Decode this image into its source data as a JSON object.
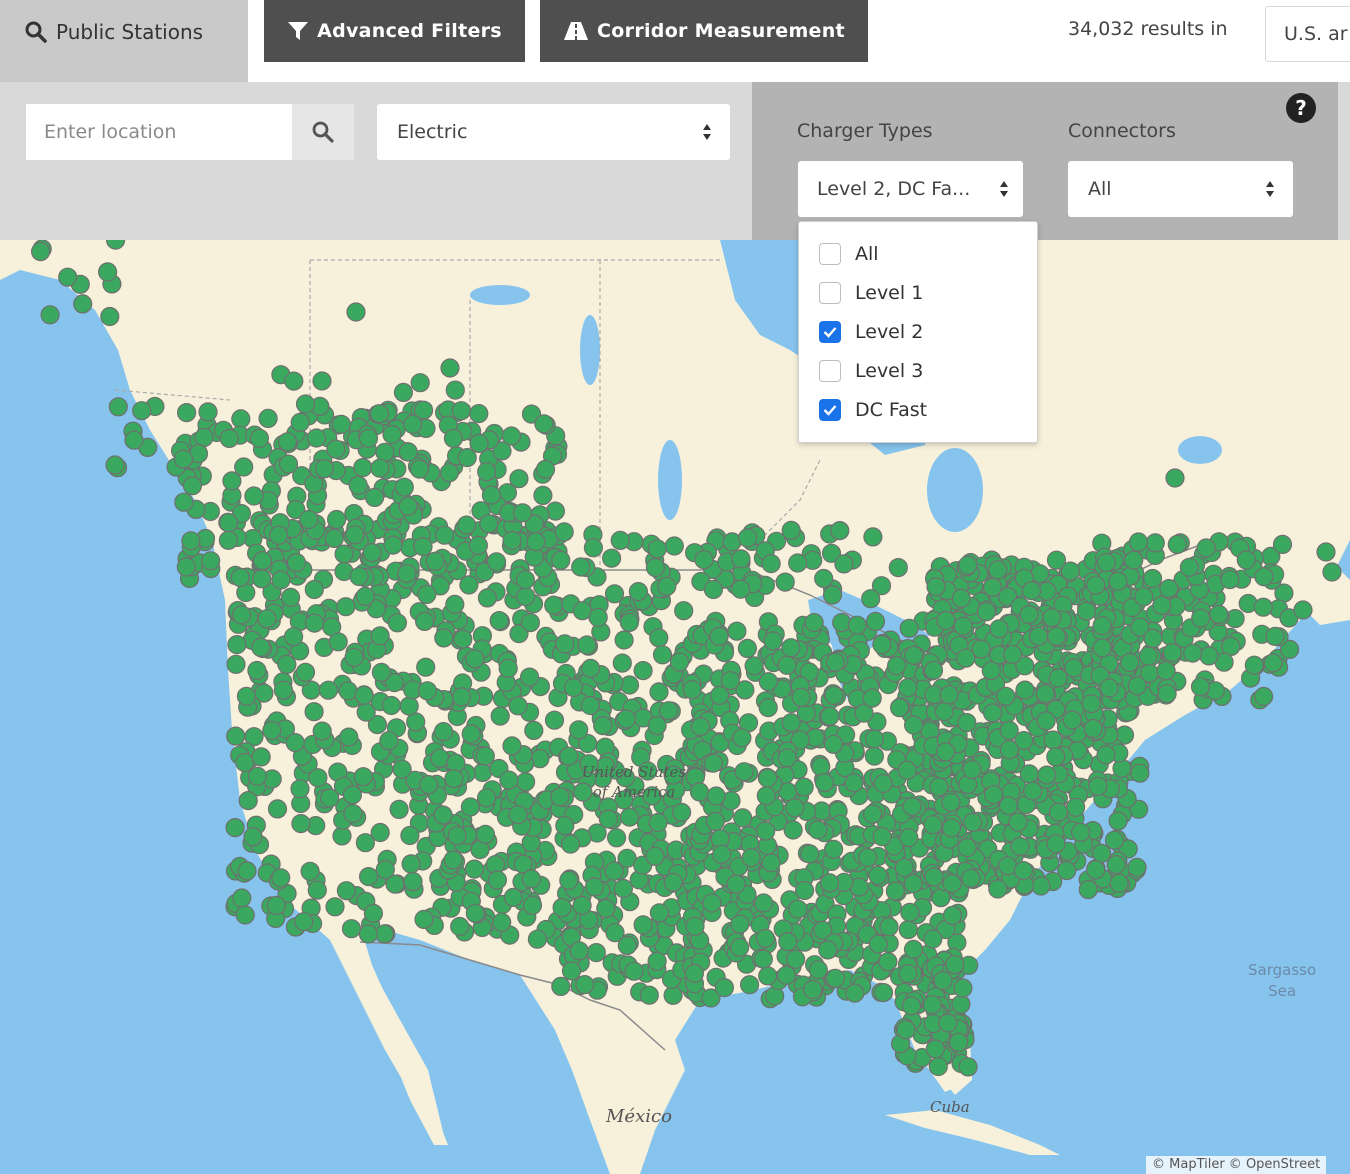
{
  "header": {
    "tab_public": "Public Stations",
    "advanced_filters": "Advanced Filters",
    "corridor_measurement": "Corridor Measurement",
    "results_text": "34,032 results in",
    "country_value": "U.S. ar"
  },
  "filters": {
    "location_placeholder": "Enter location",
    "fuel_value": "Electric",
    "charger_types_label": "Charger Types",
    "charger_types_value": "Level 2, DC Fa...",
    "connectors_label": "Connectors",
    "connectors_value": "All",
    "help_glyph": "?"
  },
  "charger_options": [
    {
      "label": "All",
      "checked": false
    },
    {
      "label": "Level 1",
      "checked": false
    },
    {
      "label": "Level 2",
      "checked": true
    },
    {
      "label": "Level 3",
      "checked": false
    },
    {
      "label": "DC Fast",
      "checked": true
    }
  ],
  "map": {
    "labels": {
      "usa_line1": "United States",
      "usa_line2": "of America",
      "mexico": "México",
      "cuba": "Cuba",
      "sargasso_line1": "Sargasso",
      "sargasso_line2": "Sea"
    },
    "attribution": "© MapTiler © OpenStreet",
    "colors": {
      "water": "#86c4ee",
      "land": "#f7f1dc",
      "marker": "#3aa85f",
      "marker_stroke": "#6f6f6f"
    }
  },
  "icons": {
    "search": "search-icon",
    "filter": "filter-icon",
    "road": "road-icon",
    "select_arrows": "select-arrows-icon",
    "help": "help-icon",
    "check": "check-icon"
  }
}
